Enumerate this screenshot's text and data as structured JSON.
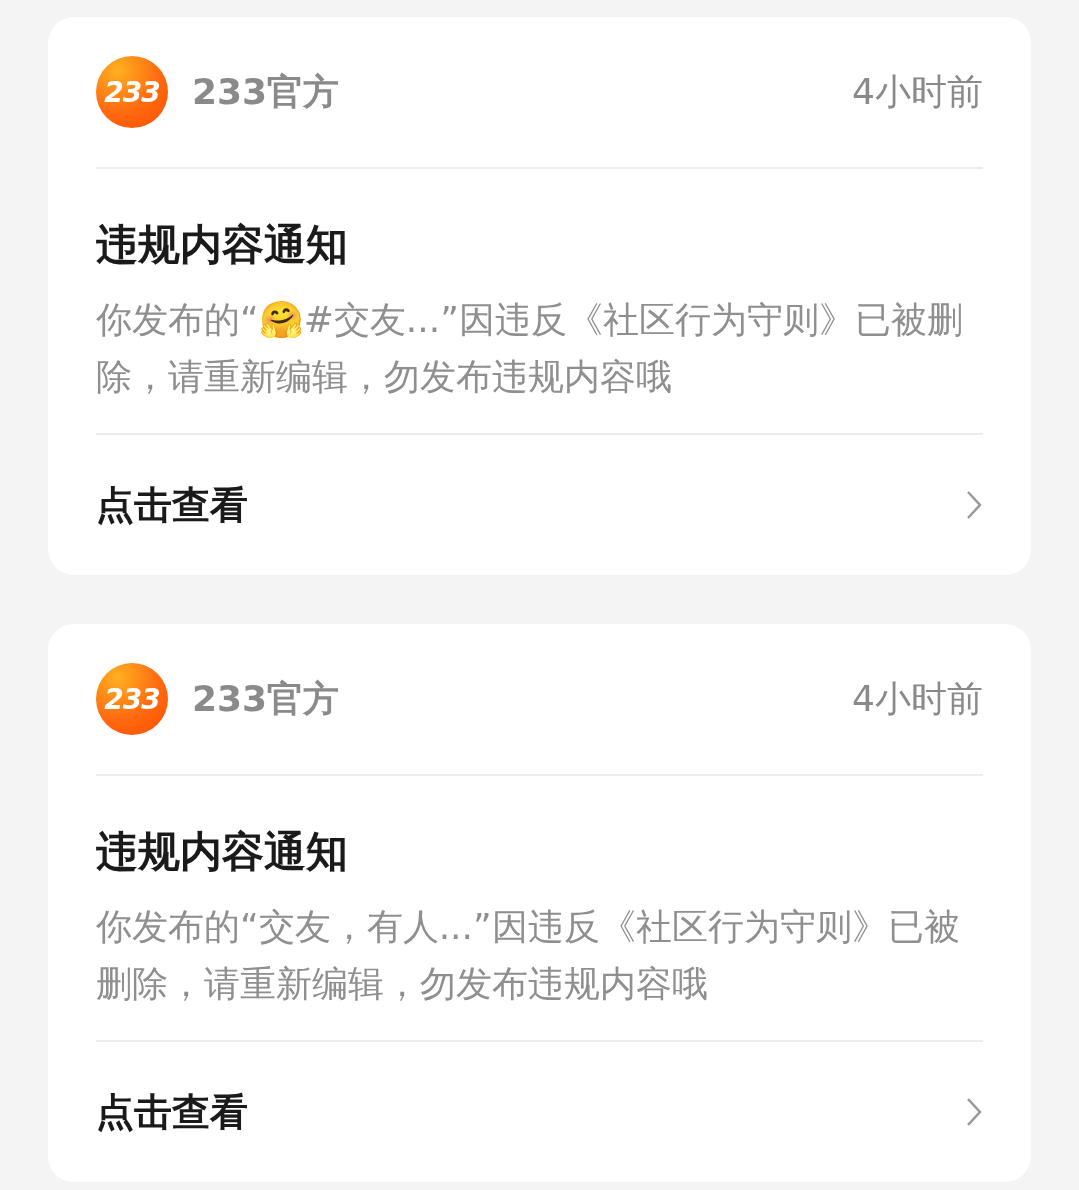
{
  "notices": [
    {
      "sender": {
        "logo": "233",
        "name": "233官方"
      },
      "time": "4小时前",
      "title": "违规内容通知",
      "message": "你发布的“🤗#交友...”因违反《社区行为守则》已被删除，请重新编辑，勿发布违规内容哦",
      "action": "点击查看"
    },
    {
      "sender": {
        "logo": "233",
        "name": "233官方"
      },
      "time": "4小时前",
      "title": "违规内容通知",
      "message": "你发布的“交友，有人...”因违反《社区行为守则》已被删除，请重新编辑，勿发布违规内容哦",
      "action": "点击查看"
    }
  ]
}
